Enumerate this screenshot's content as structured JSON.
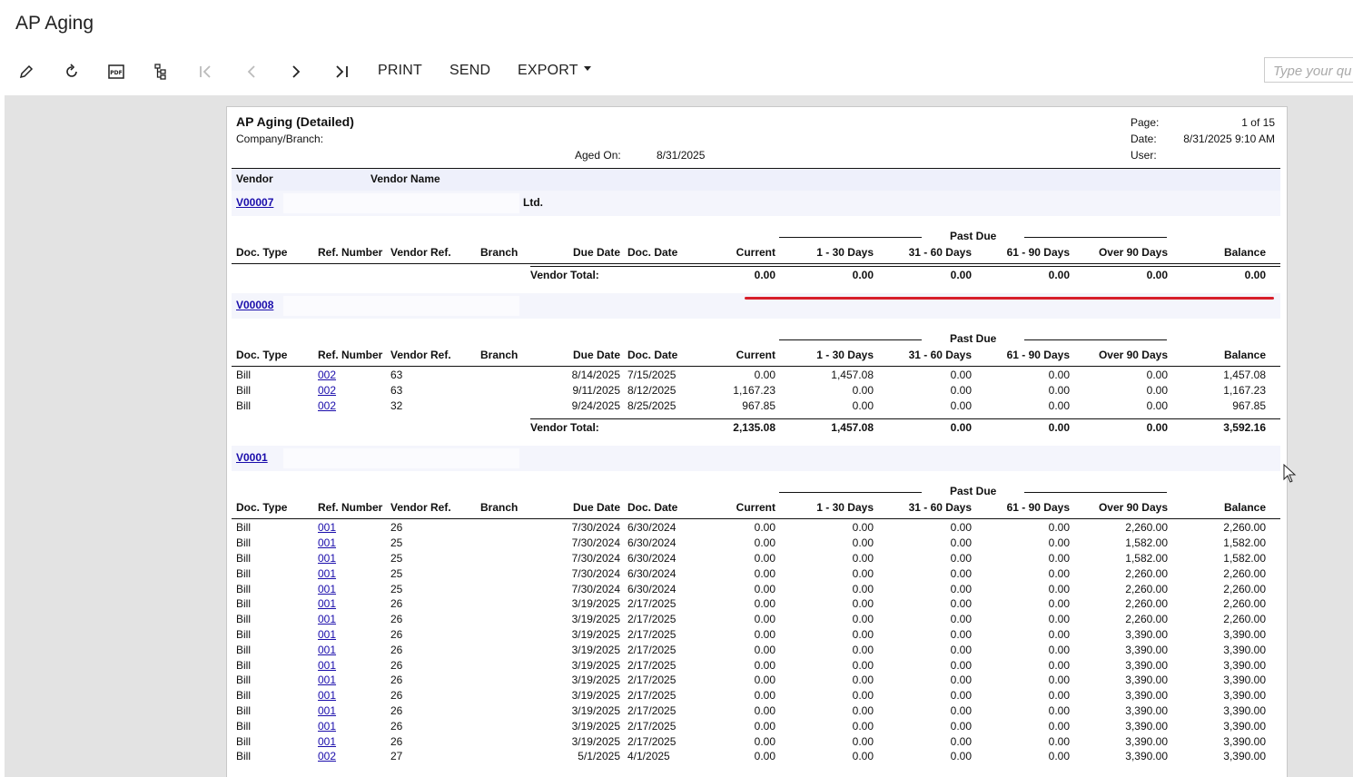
{
  "app": {
    "title": "AP Aging"
  },
  "toolbar": {
    "icons": [
      "pencil-icon",
      "refresh-icon",
      "pdf-icon",
      "tree-icon",
      "first-page-icon",
      "previous-page-icon",
      "next-page-icon",
      "last-page-icon"
    ],
    "print_label": "PRINT",
    "send_label": "SEND",
    "export_label": "EXPORT",
    "search_placeholder": "Type your qu"
  },
  "report": {
    "title": "AP Aging (Detailed)",
    "company_label": "Company/Branch:",
    "aged_on_label": "Aged On:",
    "aged_on_value": "8/31/2025",
    "page_label": "Page:",
    "page_value": "1 of 15",
    "date_label": "Date:",
    "date_value": "8/31/2025 9:10 AM",
    "user_label": "User:",
    "vendor_col": "Vendor",
    "vendor_name_col": "Vendor Name",
    "past_due_label": "Past Due",
    "vendor_total_label": "Vendor Total:",
    "columns": [
      "Doc. Type",
      "Ref. Number",
      "Vendor Ref.",
      "Branch",
      "Due Date",
      "Doc. Date",
      "Current",
      "1 - 30 Days",
      "31 - 60 Days",
      "61 - 90 Days",
      "Over 90 Days",
      "Balance"
    ]
  },
  "vendors": [
    {
      "id": "V00007",
      "name": "Ltd.",
      "rows": [],
      "total": {
        "current": "0.00",
        "d1_30": "0.00",
        "d31_60": "0.00",
        "d61_90": "0.00",
        "over90": "0.00",
        "balance": "0.00"
      }
    },
    {
      "id": "V00008",
      "name": "",
      "rows": [
        {
          "type": "Bill",
          "ref": "002",
          "vref": "63",
          "due": "8/14/2025",
          "doc": "7/15/2025",
          "cur": "0.00",
          "d1": "1,457.08",
          "d2": "0.00",
          "d3": "0.00",
          "d4": "0.00",
          "bal": "1,457.08"
        },
        {
          "type": "Bill",
          "ref": "002",
          "vref": "63",
          "due": "9/11/2025",
          "doc": "8/12/2025",
          "cur": "1,167.23",
          "d1": "0.00",
          "d2": "0.00",
          "d3": "0.00",
          "d4": "0.00",
          "bal": "1,167.23"
        },
        {
          "type": "Bill",
          "ref": "002",
          "vref": "32",
          "due": "9/24/2025",
          "doc": "8/25/2025",
          "cur": "967.85",
          "d1": "0.00",
          "d2": "0.00",
          "d3": "0.00",
          "d4": "0.00",
          "bal": "967.85"
        }
      ],
      "total": {
        "current": "2,135.08",
        "d1_30": "1,457.08",
        "d31_60": "0.00",
        "d61_90": "0.00",
        "over90": "0.00",
        "balance": "3,592.16"
      }
    },
    {
      "id": "V0001",
      "name": "",
      "rows": [
        {
          "type": "Bill",
          "ref": "001",
          "vref": "26",
          "due": "7/30/2024",
          "doc": "6/30/2024",
          "cur": "0.00",
          "d1": "0.00",
          "d2": "0.00",
          "d3": "0.00",
          "d4": "2,260.00",
          "bal": "2,260.00"
        },
        {
          "type": "Bill",
          "ref": "001",
          "vref": "25",
          "due": "7/30/2024",
          "doc": "6/30/2024",
          "cur": "0.00",
          "d1": "0.00",
          "d2": "0.00",
          "d3": "0.00",
          "d4": "1,582.00",
          "bal": "1,582.00"
        },
        {
          "type": "Bill",
          "ref": "001",
          "vref": "25",
          "due": "7/30/2024",
          "doc": "6/30/2024",
          "cur": "0.00",
          "d1": "0.00",
          "d2": "0.00",
          "d3": "0.00",
          "d4": "1,582.00",
          "bal": "1,582.00"
        },
        {
          "type": "Bill",
          "ref": "001",
          "vref": "25",
          "due": "7/30/2024",
          "doc": "6/30/2024",
          "cur": "0.00",
          "d1": "0.00",
          "d2": "0.00",
          "d3": "0.00",
          "d4": "2,260.00",
          "bal": "2,260.00"
        },
        {
          "type": "Bill",
          "ref": "001",
          "vref": "25",
          "due": "7/30/2024",
          "doc": "6/30/2024",
          "cur": "0.00",
          "d1": "0.00",
          "d2": "0.00",
          "d3": "0.00",
          "d4": "2,260.00",
          "bal": "2,260.00"
        },
        {
          "type": "Bill",
          "ref": "001",
          "vref": "26",
          "due": "3/19/2025",
          "doc": "2/17/2025",
          "cur": "0.00",
          "d1": "0.00",
          "d2": "0.00",
          "d3": "0.00",
          "d4": "2,260.00",
          "bal": "2,260.00"
        },
        {
          "type": "Bill",
          "ref": "001",
          "vref": "26",
          "due": "3/19/2025",
          "doc": "2/17/2025",
          "cur": "0.00",
          "d1": "0.00",
          "d2": "0.00",
          "d3": "0.00",
          "d4": "2,260.00",
          "bal": "2,260.00"
        },
        {
          "type": "Bill",
          "ref": "001",
          "vref": "26",
          "due": "3/19/2025",
          "doc": "2/17/2025",
          "cur": "0.00",
          "d1": "0.00",
          "d2": "0.00",
          "d3": "0.00",
          "d4": "3,390.00",
          "bal": "3,390.00"
        },
        {
          "type": "Bill",
          "ref": "001",
          "vref": "26",
          "due": "3/19/2025",
          "doc": "2/17/2025",
          "cur": "0.00",
          "d1": "0.00",
          "d2": "0.00",
          "d3": "0.00",
          "d4": "3,390.00",
          "bal": "3,390.00"
        },
        {
          "type": "Bill",
          "ref": "001",
          "vref": "26",
          "due": "3/19/2025",
          "doc": "2/17/2025",
          "cur": "0.00",
          "d1": "0.00",
          "d2": "0.00",
          "d3": "0.00",
          "d4": "3,390.00",
          "bal": "3,390.00"
        },
        {
          "type": "Bill",
          "ref": "001",
          "vref": "26",
          "due": "3/19/2025",
          "doc": "2/17/2025",
          "cur": "0.00",
          "d1": "0.00",
          "d2": "0.00",
          "d3": "0.00",
          "d4": "3,390.00",
          "bal": "3,390.00"
        },
        {
          "type": "Bill",
          "ref": "001",
          "vref": "26",
          "due": "3/19/2025",
          "doc": "2/17/2025",
          "cur": "0.00",
          "d1": "0.00",
          "d2": "0.00",
          "d3": "0.00",
          "d4": "3,390.00",
          "bal": "3,390.00"
        },
        {
          "type": "Bill",
          "ref": "001",
          "vref": "26",
          "due": "3/19/2025",
          "doc": "2/17/2025",
          "cur": "0.00",
          "d1": "0.00",
          "d2": "0.00",
          "d3": "0.00",
          "d4": "3,390.00",
          "bal": "3,390.00"
        },
        {
          "type": "Bill",
          "ref": "001",
          "vref": "26",
          "due": "3/19/2025",
          "doc": "2/17/2025",
          "cur": "0.00",
          "d1": "0.00",
          "d2": "0.00",
          "d3": "0.00",
          "d4": "3,390.00",
          "bal": "3,390.00"
        },
        {
          "type": "Bill",
          "ref": "001",
          "vref": "26",
          "due": "3/19/2025",
          "doc": "2/17/2025",
          "cur": "0.00",
          "d1": "0.00",
          "d2": "0.00",
          "d3": "0.00",
          "d4": "3,390.00",
          "bal": "3,390.00"
        },
        {
          "type": "Bill",
          "ref": "002",
          "vref": "27",
          "due": "5/1/2025",
          "doc": "4/1/2025",
          "cur": "0.00",
          "d1": "0.00",
          "d2": "0.00",
          "d3": "0.00",
          "d4": "3,390.00",
          "bal": "3,390.00"
        }
      ]
    }
  ],
  "colors": {
    "accent_red": "#d71f2a",
    "link": "#1a0dab",
    "band": "#eef0fb"
  }
}
